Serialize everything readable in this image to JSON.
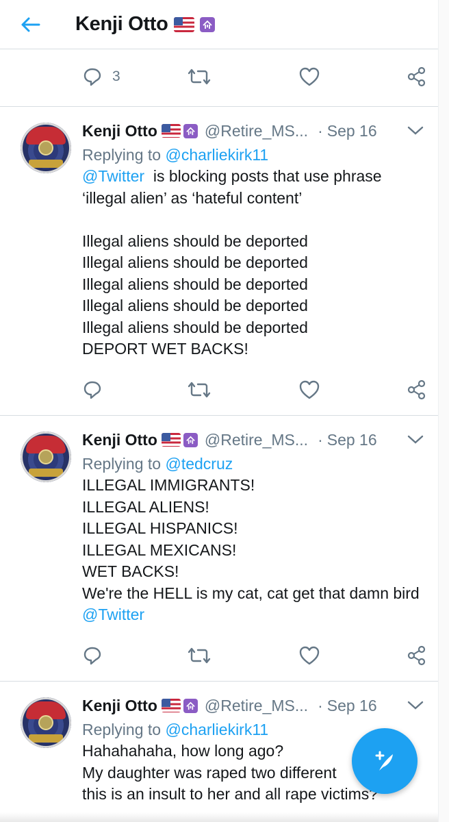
{
  "header": {
    "back_icon": "arrow-left-icon",
    "title": "Kenji Otto"
  },
  "top_actions": {
    "reply_count": "3"
  },
  "tweets": [
    {
      "name": "Kenji Otto",
      "handle": "@Retire_MS...",
      "dot": "·",
      "date": "Sep 16",
      "replying_prefix": "Replying to ",
      "replying_to": "@charliekirk11",
      "mention": "@Twitter",
      "text_after_mention": "  is blocking posts that use phrase ‘illegal alien’ as ‘hateful content’",
      "body": "\nIllegal aliens should be deported\nIllegal aliens should be deported\nIllegal aliens should be deported\nIllegal aliens should be deported\nIllegal aliens should be deported\nDEPORT WET BACKS!"
    },
    {
      "name": "Kenji Otto",
      "handle": "@Retire_MS...",
      "dot": "·",
      "date": "Sep 16",
      "replying_prefix": "Replying to ",
      "replying_to": "@tedcruz",
      "body": "ILLEGAL IMMIGRANTS!\nILLEGAL ALIENS!\nILLEGAL HISPANICS!\nILLEGAL MEXICANS!\nWET BACKS!\nWe're the HELL is my cat, cat get that damn bird ",
      "trailing_mention": "@Twitter"
    },
    {
      "name": "Kenji Otto",
      "handle": "@Retire_MS...",
      "dot": "·",
      "date": "Sep 16",
      "replying_prefix": "Replying to ",
      "replying_to": "@charliekirk11",
      "body": "Hahahahaha, how long ago?\nMy daughter was raped two different\nthis is an insult to her and all rape victims?"
    }
  ],
  "colors": {
    "accent": "#1da1f2",
    "muted": "#657786",
    "badge": "#8b5cc4"
  },
  "fab": {
    "icon": "compose-tweet-icon"
  }
}
